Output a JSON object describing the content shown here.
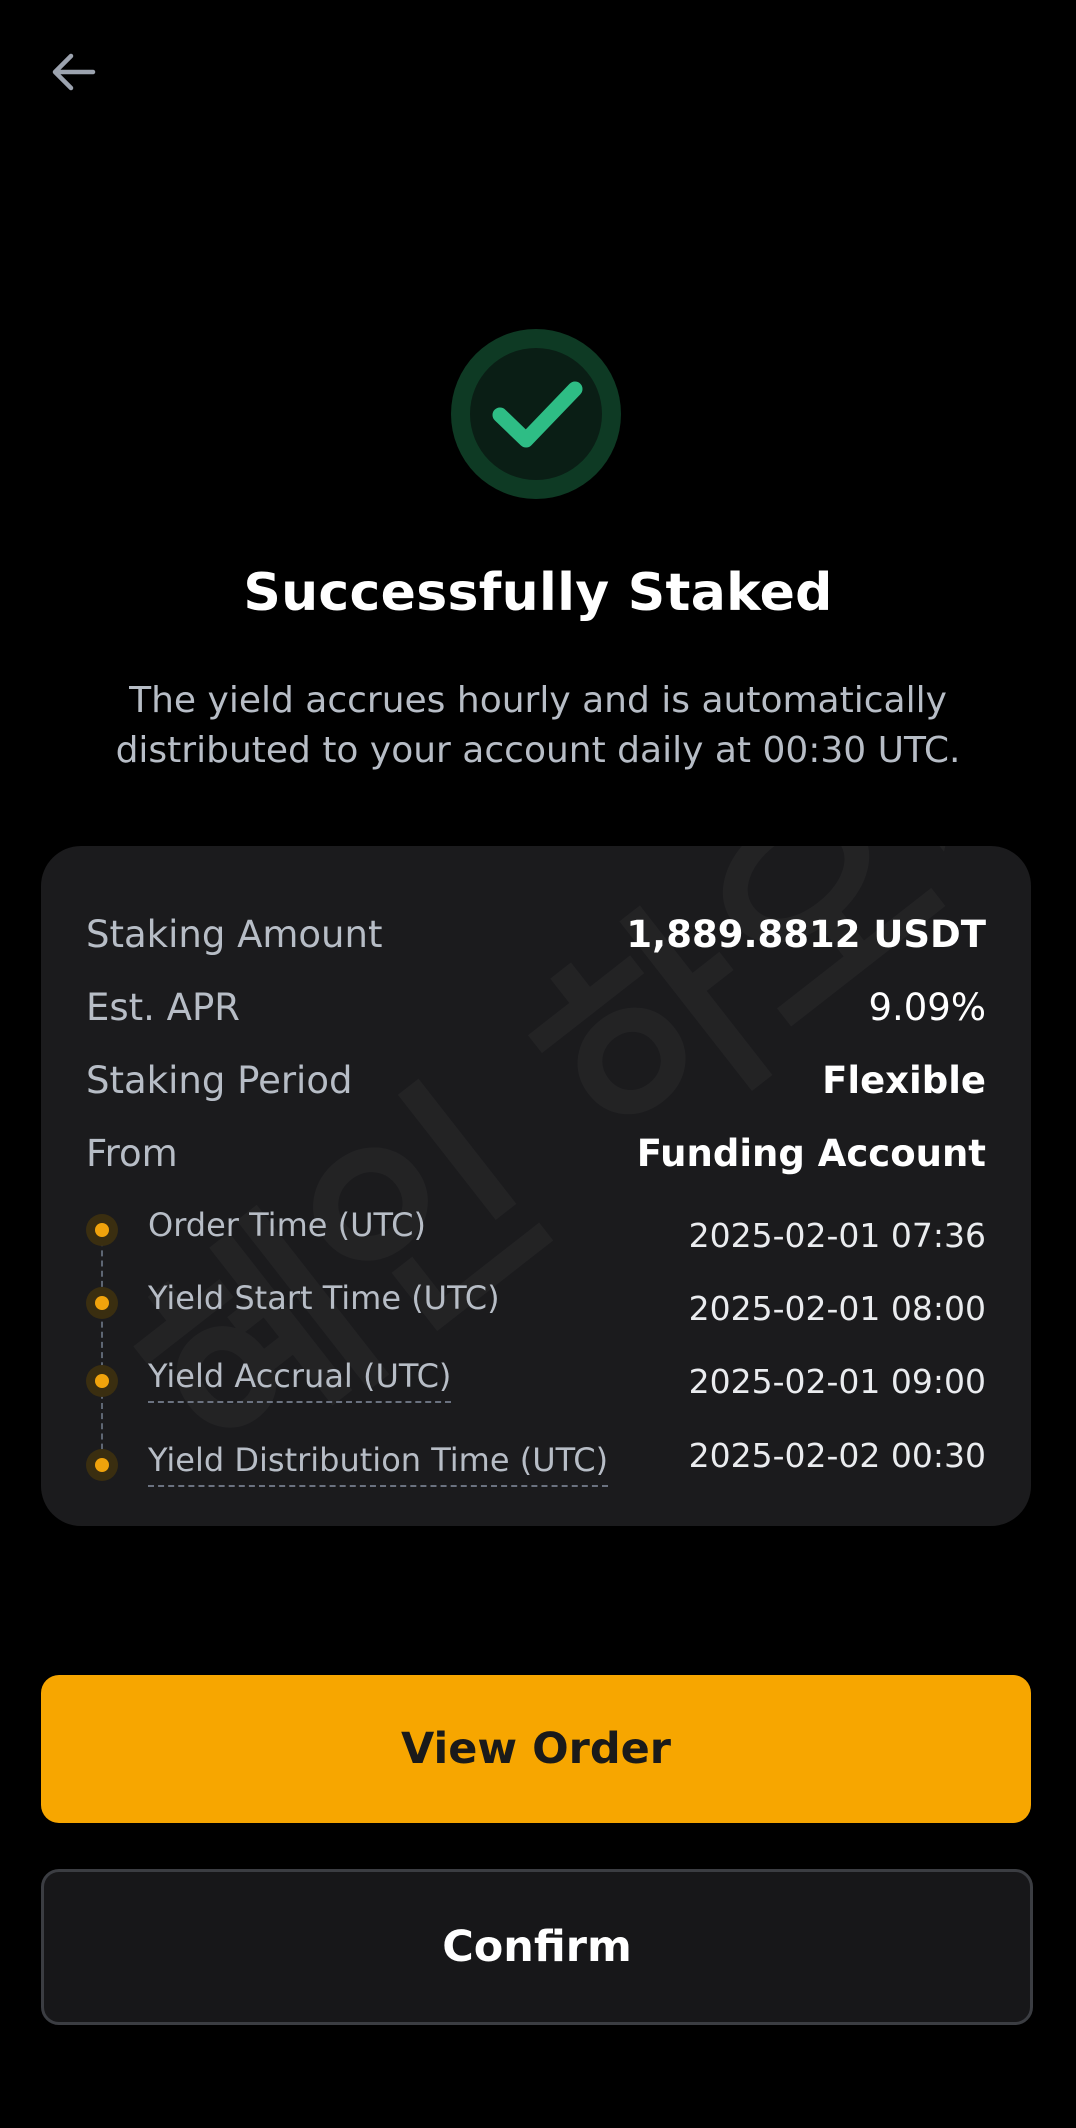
{
  "nav": {
    "back_icon": "arrow-left-icon"
  },
  "status": {
    "icon": "check-circle-icon",
    "title": "Successfully Staked",
    "subtitle": "The yield accrues hourly and is automatically distributed to your account daily at 00:30 UTC."
  },
  "details": {
    "rows": [
      {
        "label": "Staking Amount",
        "value": "1,889.8812 USDT"
      },
      {
        "label": "Est. APR",
        "value": "9.09%"
      },
      {
        "label": "Staking Period",
        "value": "Flexible"
      },
      {
        "label": "From",
        "value": "Funding Account"
      }
    ],
    "timeline": [
      {
        "label": "Order Time (UTC)",
        "value": "2025-02-01 07:36"
      },
      {
        "label": "Yield Start Time (UTC)",
        "value": "2025-02-01 08:00"
      },
      {
        "label": "Yield Accrual (UTC)",
        "value": "2025-02-01 09:00"
      },
      {
        "label": "Yield Distribution Time (UTC)",
        "value": "2025-02-02 00:30"
      }
    ],
    "watermark": "혜인 하오~"
  },
  "actions": {
    "primary_label": "View Order",
    "secondary_label": "Confirm"
  },
  "colors": {
    "accent": "#F7A600",
    "success": "#2EBD85",
    "background": "#000000",
    "card": "#1B1B1D"
  }
}
